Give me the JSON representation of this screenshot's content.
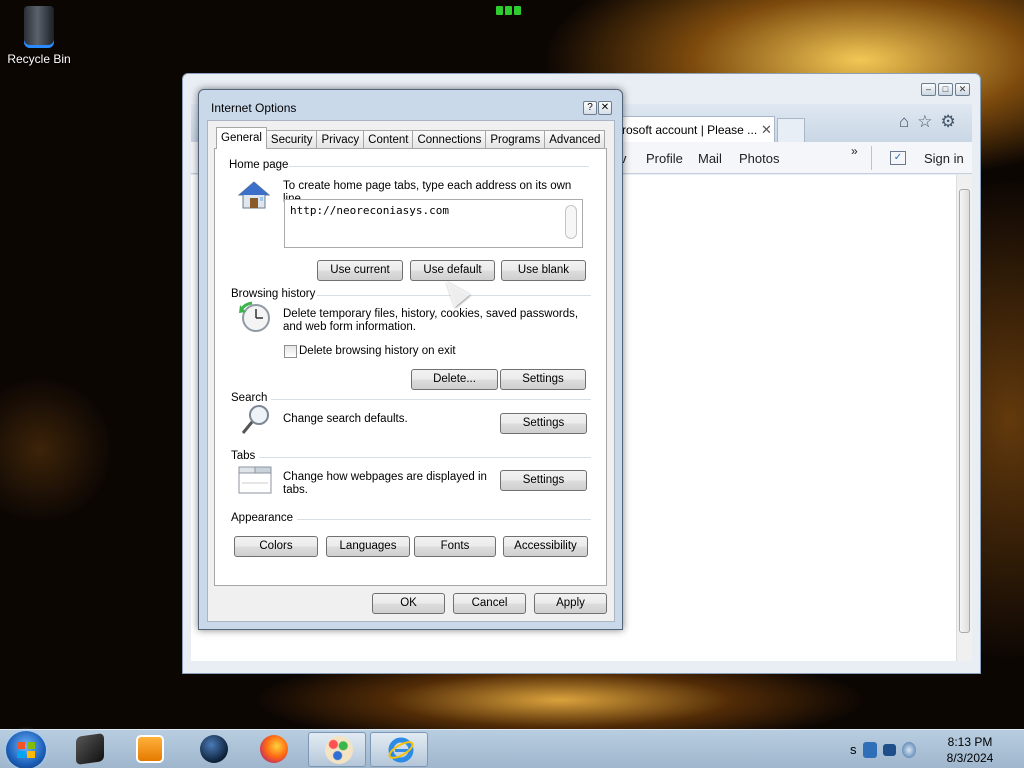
{
  "desktop": {
    "recycle_bin_label": "Recycle Bin"
  },
  "browser": {
    "tab_title": "rosoft account | Please ...",
    "tab_close": "✕",
    "window_buttons": [
      "–",
      "□",
      "✕"
    ],
    "command_links": [
      "v",
      "Profile",
      "Mail",
      "Photos"
    ],
    "more_glyph": "»",
    "sign_in": "Sign in"
  },
  "dialog": {
    "title": "Internet Options",
    "help_glyph": "?",
    "close_glyph": "✕",
    "tabs": [
      "General",
      "Security",
      "Privacy",
      "Content",
      "Connections",
      "Programs",
      "Advanced"
    ],
    "active_tab": "General",
    "home_page": {
      "label": "Home page",
      "description": "To create home page tabs, type each address on its own line.",
      "url": "http://neoreconiasys.com",
      "use_current": "Use current",
      "use_default": "Use default",
      "use_blank": "Use blank"
    },
    "browsing_history": {
      "label": "Browsing history",
      "description": "Delete temporary files, history, cookies, saved passwords, and web form information.",
      "delete_on_exit_label": "Delete browsing history on exit",
      "delete_on_exit_checked": false,
      "delete_button": "Delete...",
      "settings_button": "Settings"
    },
    "search": {
      "label": "Search",
      "description": "Change search defaults.",
      "settings_button": "Settings"
    },
    "tabs_section": {
      "label": "Tabs",
      "description": "Change how webpages are displayed in tabs.",
      "settings_button": "Settings"
    },
    "appearance": {
      "label": "Appearance",
      "colors": "Colors",
      "languages": "Languages",
      "fonts": "Fonts",
      "accessibility": "Accessibility"
    },
    "ok": "OK",
    "cancel": "Cancel",
    "apply": "Apply"
  },
  "taskbar": {
    "pinned": [
      "Desktop",
      "Media Player",
      "Globe App",
      "Firefox",
      "Paint",
      "Internet Explorer"
    ],
    "time": "8:13 PM",
    "date": "8/3/2024",
    "tray_text": "s"
  },
  "colors": {
    "accent": "#3a7bd5",
    "dialog_frame": "#c9d9ea",
    "taskbar": "#a9c0d6"
  }
}
